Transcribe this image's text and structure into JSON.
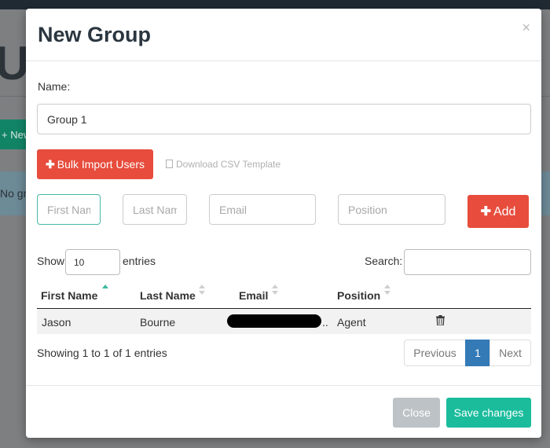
{
  "background": {
    "page_title_fragment": "Us",
    "new_button_fragment": "+ New",
    "alert_fragment": "No gr"
  },
  "modal": {
    "title": "New Group",
    "close_icon": "×"
  },
  "name_field": {
    "label": "Name:",
    "value": "Group 1"
  },
  "bulk_import": {
    "label": "Bulk Import Users",
    "icon": "plus-icon"
  },
  "csv_template": {
    "label": "Download CSV Template",
    "icon": "file-icon"
  },
  "user_form": {
    "first_name_placeholder": "First Name",
    "last_name_placeholder": "Last Name",
    "email_placeholder": "Email",
    "position_placeholder": "Position",
    "add_label": "Add"
  },
  "table_controls": {
    "show_label": "Show",
    "entries_value": "10",
    "entries_label": "entries",
    "search_label": "Search:"
  },
  "table": {
    "columns": [
      "First Name",
      "Last Name",
      "Email",
      "Position"
    ],
    "rows": [
      {
        "first_name": "Jason",
        "last_name": "Bourne",
        "email_suffix": "..",
        "position": "Agent"
      }
    ]
  },
  "pagination": {
    "info": "Showing 1 to 1 of 1 entries",
    "previous": "Previous",
    "current_page": "1",
    "next": "Next"
  },
  "footer": {
    "close_label": "Close",
    "save_label": "Save changes"
  },
  "colors": {
    "danger": "#e74c3c",
    "success": "#1abc9c",
    "primary": "#337ab7",
    "focus_border": "#45b9a6",
    "sort_active": "#3bb89f"
  }
}
